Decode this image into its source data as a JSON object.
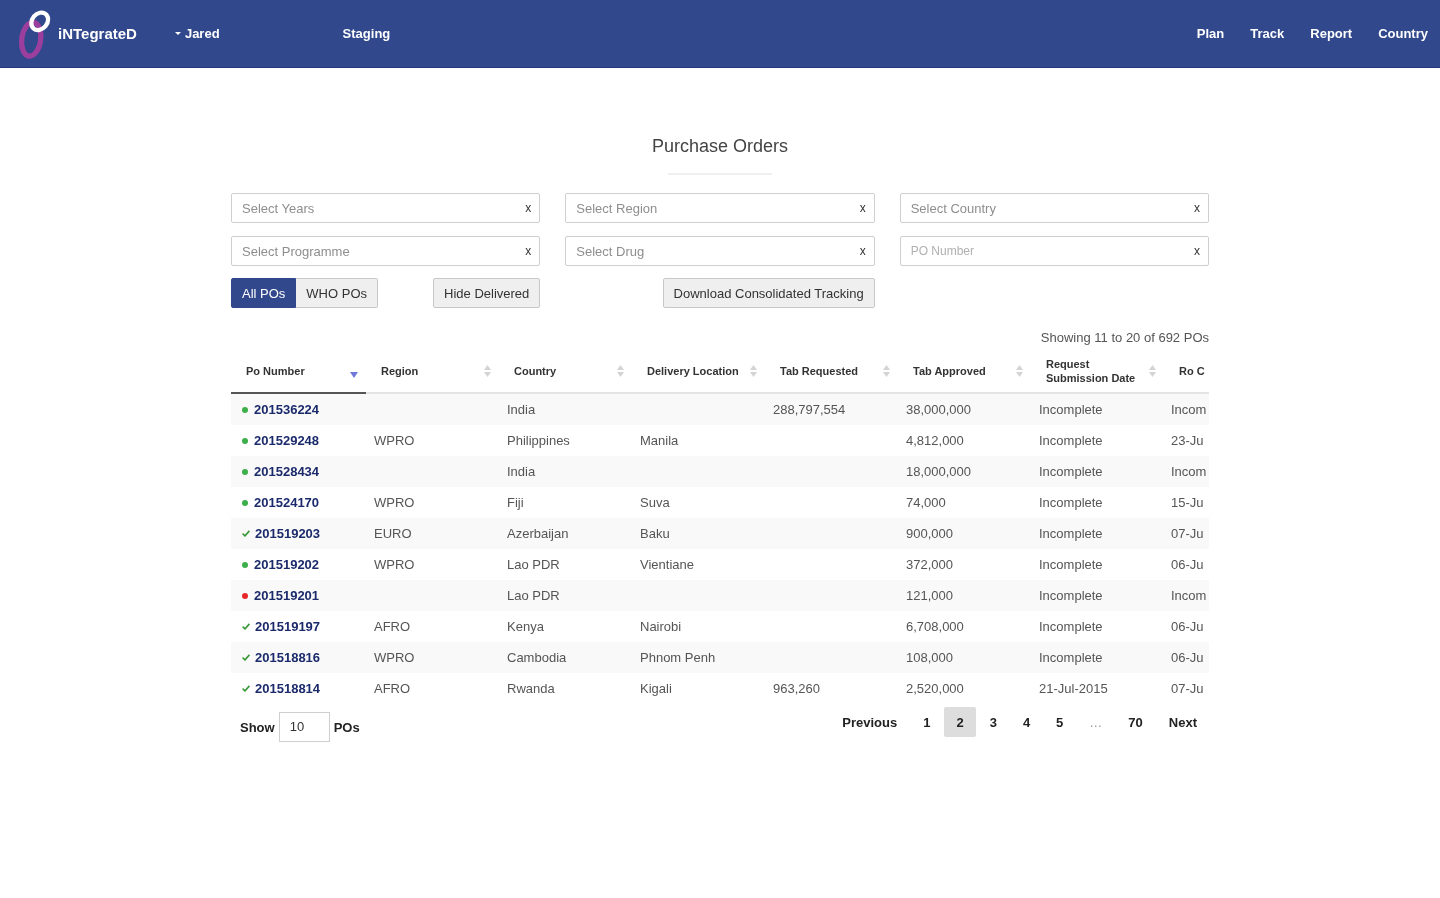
{
  "navbar": {
    "brand": "iNTegrateD",
    "user_menu": "Jared",
    "environment": "Staging",
    "menu": [
      "Plan",
      "Track",
      "Report",
      "Country"
    ]
  },
  "page_title": "Purchase Orders",
  "filters": [
    {
      "kind": "select",
      "placeholder": "Select Years",
      "clear": "x"
    },
    {
      "kind": "select",
      "placeholder": "Select Region",
      "clear": "x"
    },
    {
      "kind": "select",
      "placeholder": "Select Country",
      "clear": "x"
    },
    {
      "kind": "select",
      "placeholder": "Select Programme",
      "clear": "x"
    },
    {
      "kind": "select",
      "placeholder": "Select Drug",
      "clear": "x"
    },
    {
      "kind": "input",
      "placeholder": "PO Number",
      "clear": "x"
    }
  ],
  "po_scope": [
    {
      "label": "All POs",
      "selected": true
    },
    {
      "label": "WHO POs",
      "selected": false
    }
  ],
  "actions": [
    "Hide Delivered",
    "Download Consolidated Tracking"
  ],
  "summary": "Showing 11 to 20 of 692 POs",
  "table": {
    "columns": [
      {
        "label": "Po Number",
        "sorted": true,
        "descending": true
      },
      {
        "label": "Region",
        "sorted": false
      },
      {
        "label": "Country",
        "sorted": false
      },
      {
        "label": "Delivery Location",
        "sorted": false
      },
      {
        "label": "Tab Requested",
        "sorted": false
      },
      {
        "label": "Tab Approved",
        "sorted": false
      },
      {
        "label": "Request Submission Date",
        "sorted": false
      },
      {
        "label": "Ro C"
      }
    ],
    "rows": [
      {
        "po_number": "201536224",
        "status": {
          "kind": "dot",
          "color": "#3cae4a"
        },
        "country": "India",
        "tab_requested": "288,797,554",
        "tab_approved": "38,000,000",
        "request_submission_date": "Incomplete",
        "column_8": "Incom"
      },
      {
        "po_number": "201529248",
        "status": {
          "kind": "dot",
          "color": "#3cae4a"
        },
        "region": "WPRO",
        "country": "Philippines",
        "delivery_location": "Manila",
        "tab_approved": "4,812,000",
        "request_submission_date": "Incomplete",
        "column_8": "23-Ju"
      },
      {
        "po_number": "201528434",
        "status": {
          "kind": "dot",
          "color": "#3cae4a"
        },
        "country": "India",
        "tab_approved": "18,000,000",
        "request_submission_date": "Incomplete",
        "column_8": "Incom"
      },
      {
        "po_number": "201524170",
        "status": {
          "kind": "dot",
          "color": "#3cae4a"
        },
        "region": "WPRO",
        "country": "Fiji",
        "delivery_location": "Suva",
        "tab_approved": "74,000",
        "request_submission_date": "Incomplete",
        "column_8": "15-Ju"
      },
      {
        "po_number": "201519203",
        "status": {
          "kind": "check",
          "color": "#3a9a3a"
        },
        "region": "EURO",
        "country": "Azerbaijan",
        "delivery_location": "Baku",
        "tab_approved": "900,000",
        "request_submission_date": "Incomplete",
        "column_8": "07-Ju"
      },
      {
        "po_number": "201519202",
        "status": {
          "kind": "dot",
          "color": "#3cae4a"
        },
        "region": "WPRO",
        "country": "Lao PDR",
        "delivery_location": "Vientiane",
        "tab_approved": "372,000",
        "request_submission_date": "Incomplete",
        "column_8": "06-Ju"
      },
      {
        "po_number": "201519201",
        "status": {
          "kind": "dot",
          "color": "#e8262a"
        },
        "country": "Lao PDR",
        "tab_approved": "121,000",
        "request_submission_date": "Incomplete",
        "column_8": "Incom"
      },
      {
        "po_number": "201519197",
        "status": {
          "kind": "check",
          "color": "#3a9a3a"
        },
        "region": "AFRO",
        "country": "Kenya",
        "delivery_location": "Nairobi",
        "tab_approved": "6,708,000",
        "request_submission_date": "Incomplete",
        "column_8": "06-Ju"
      },
      {
        "po_number": "201518816",
        "status": {
          "kind": "check",
          "color": "#3a9a3a"
        },
        "region": "WPRO",
        "country": "Cambodia",
        "delivery_location": "Phnom Penh",
        "tab_approved": "108,000",
        "request_submission_date": "Incomplete",
        "column_8": "06-Ju"
      },
      {
        "po_number": "201518814",
        "status": {
          "kind": "check",
          "color": "#3a9a3a"
        },
        "region": "AFRO",
        "country": "Rwanda",
        "delivery_location": "Kigali",
        "tab_requested": "963,260",
        "tab_approved": "2,520,000",
        "request_submission_date": "21-Jul-2015",
        "column_8": "07-Ju"
      }
    ]
  },
  "page_size": {
    "label": "Show",
    "value": "10",
    "unit": "POs"
  },
  "pagination": [
    {
      "label": "Previous",
      "selected": false,
      "disabled": false
    },
    {
      "label": "1",
      "selected": false,
      "disabled": false
    },
    {
      "label": "2",
      "selected": true,
      "disabled": false
    },
    {
      "label": "3",
      "selected": false,
      "disabled": false
    },
    {
      "label": "4",
      "selected": false,
      "disabled": false
    },
    {
      "label": "5",
      "selected": false,
      "disabled": false
    },
    {
      "label": "…",
      "selected": false,
      "disabled": true
    },
    {
      "label": "70",
      "selected": false,
      "disabled": false
    },
    {
      "label": "Next",
      "selected": false,
      "disabled": false
    }
  ]
}
